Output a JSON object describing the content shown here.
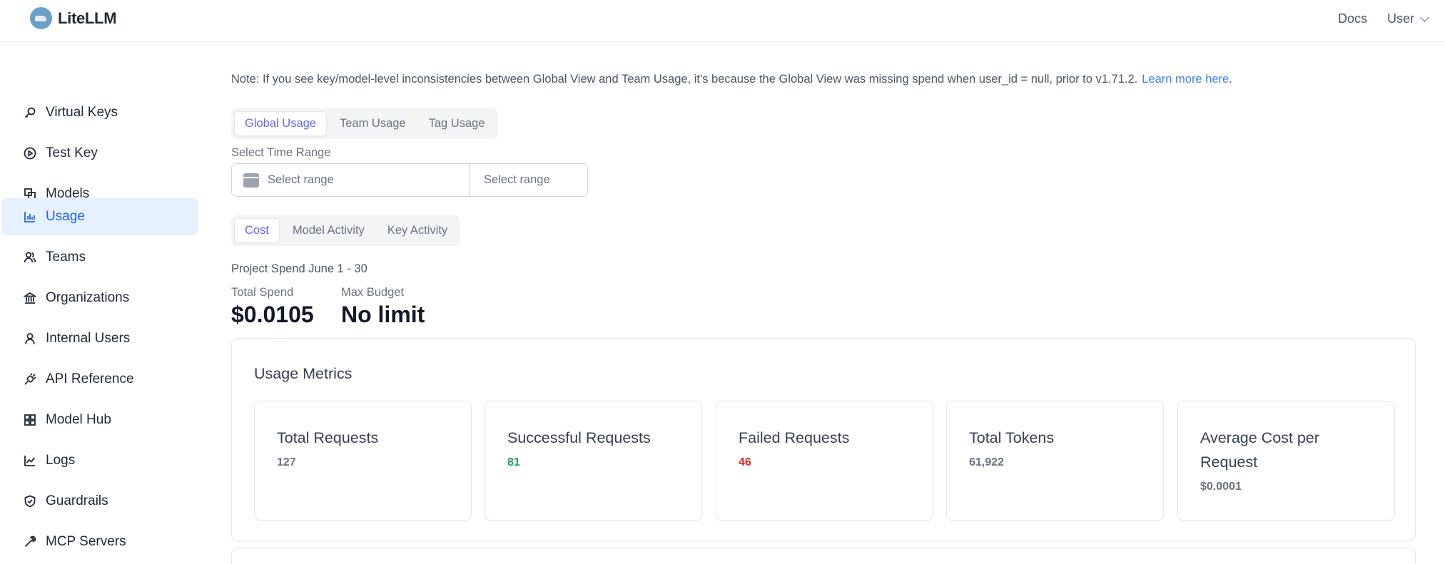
{
  "header": {
    "app_name": "LiteLLM",
    "docs_label": "Docs",
    "user_label": "User"
  },
  "sidebar": {
    "items": [
      {
        "label": "Virtual Keys",
        "icon": "key-icon"
      },
      {
        "label": "Test Key",
        "icon": "play-circle-icon"
      },
      {
        "label": "Models",
        "icon": "block-icon"
      },
      {
        "label": "Usage",
        "icon": "bar-chart-icon",
        "active": true
      },
      {
        "label": "Teams",
        "icon": "team-icon"
      },
      {
        "label": "Organizations",
        "icon": "bank-icon"
      },
      {
        "label": "Internal Users",
        "icon": "user-icon"
      },
      {
        "label": "API Reference",
        "icon": "api-icon"
      },
      {
        "label": "Model Hub",
        "icon": "app-store-icon"
      },
      {
        "label": "Logs",
        "icon": "line-chart-icon"
      },
      {
        "label": "Guardrails",
        "icon": "safety-icon"
      },
      {
        "label": "MCP Servers",
        "icon": "tool-icon"
      }
    ]
  },
  "main": {
    "note_text": "Note: If you see key/model-level inconsistencies between Global View and Team Usage, it's because the Global View was missing spend when user_id = null, prior to v1.71.2.",
    "note_link": "Learn more here",
    "note_link_suffix": ".",
    "usage_tabs": [
      {
        "label": "Global Usage",
        "active": true
      },
      {
        "label": "Team Usage",
        "active": false
      },
      {
        "label": "Tag Usage",
        "active": false
      }
    ],
    "time_range_label": "Select Time Range",
    "range_start_placeholder": "Select range",
    "range_end_placeholder": "Select range",
    "view_tabs": [
      {
        "label": "Cost",
        "active": true
      },
      {
        "label": "Model Activity",
        "active": false
      },
      {
        "label": "Key Activity",
        "active": false
      }
    ],
    "project_spend_label": "Project Spend June 1 - 30",
    "total_spend_label": "Total Spend",
    "total_spend_value": "$0.0105",
    "max_budget_label": "Max Budget",
    "max_budget_value": "No limit",
    "usage_metrics": {
      "title": "Usage Metrics",
      "metrics": [
        {
          "title": "Total Requests",
          "value": "127",
          "color": "#6b7280"
        },
        {
          "title": "Successful Requests",
          "value": "81",
          "color": "#16a34a"
        },
        {
          "title": "Failed Requests",
          "value": "46",
          "color": "#dc2626"
        },
        {
          "title": "Total Tokens",
          "value": "61,922",
          "color": "#6b7280"
        },
        {
          "title": "Average Cost per Request",
          "value": "$0.0001",
          "color": "#6b7280"
        }
      ]
    }
  },
  "colors": {
    "accent": "#6366f1",
    "link": "#3b82f6",
    "active_nav_bg": "#e6f1ff",
    "active_nav_text": "#2563eb"
  }
}
